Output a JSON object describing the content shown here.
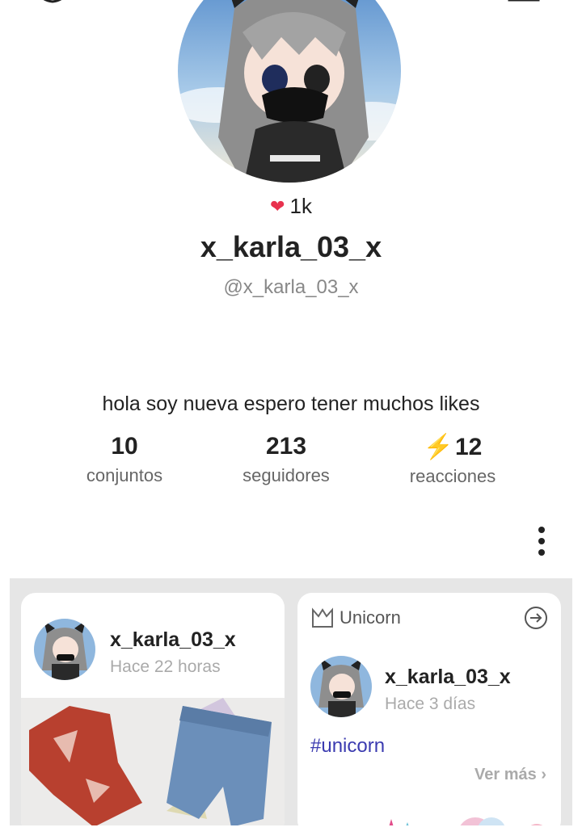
{
  "profile": {
    "likes": "1k",
    "username": "x_karla_03_x",
    "handle": "@x_karla_03_x",
    "bio": "hola soy nueva espero tener muchos likes"
  },
  "stats": [
    {
      "value": "10",
      "label": "conjuntos"
    },
    {
      "value": "213",
      "label": "seguidores"
    },
    {
      "value": "12",
      "label": "reacciones"
    }
  ],
  "feed": {
    "card1": {
      "name": "x_karla_03_x",
      "time": "Hace 22 horas"
    },
    "card2": {
      "badge": "Unicorn",
      "name": "x_karla_03_x",
      "time": "Hace 3 días",
      "hashtag": "#unicorn",
      "more": "Ver más"
    }
  },
  "colors": {
    "heart": "#e8324e",
    "bolt": "#f08a2c",
    "hashtag": "#3b3bb0"
  }
}
